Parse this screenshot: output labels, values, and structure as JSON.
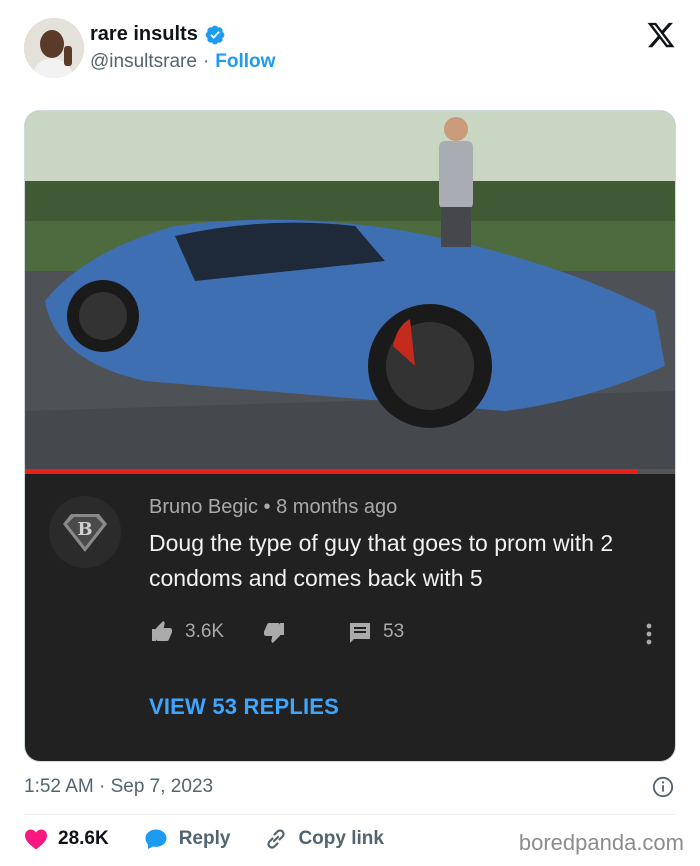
{
  "tweet": {
    "display_name": "rare insults",
    "handle": "@insultsrare",
    "separator": "·",
    "follow_label": "Follow",
    "timestamp": "1:52 AM · Sep 7, 2023",
    "likes": "28.6K",
    "reply_label": "Reply",
    "copy_link_label": "Copy link"
  },
  "youtube_comment": {
    "author": "Bruno Begic",
    "meta_separator": "•",
    "time_ago": "8 months ago",
    "text": "Doug the type of guy that goes to prom with 2 condoms and comes back with 5",
    "likes": "3.6K",
    "replies_count": "53",
    "view_replies_label": "VIEW 53 REPLIES",
    "video_progress": 0.94
  },
  "watermark": "boredpanda.com",
  "colors": {
    "accent_blue": "#1d9bf0",
    "like_pink": "#f91880",
    "youtube_red": "#e62117",
    "link_blue": "#3ea6ff",
    "comment_bg": "#212121"
  },
  "icons": [
    "verified-badge-icon",
    "x-logo-icon",
    "thumbs-up-icon",
    "thumbs-down-icon",
    "comment-icon",
    "more-vertical-icon",
    "info-icon",
    "heart-icon",
    "reply-bubble-icon",
    "link-icon"
  ]
}
